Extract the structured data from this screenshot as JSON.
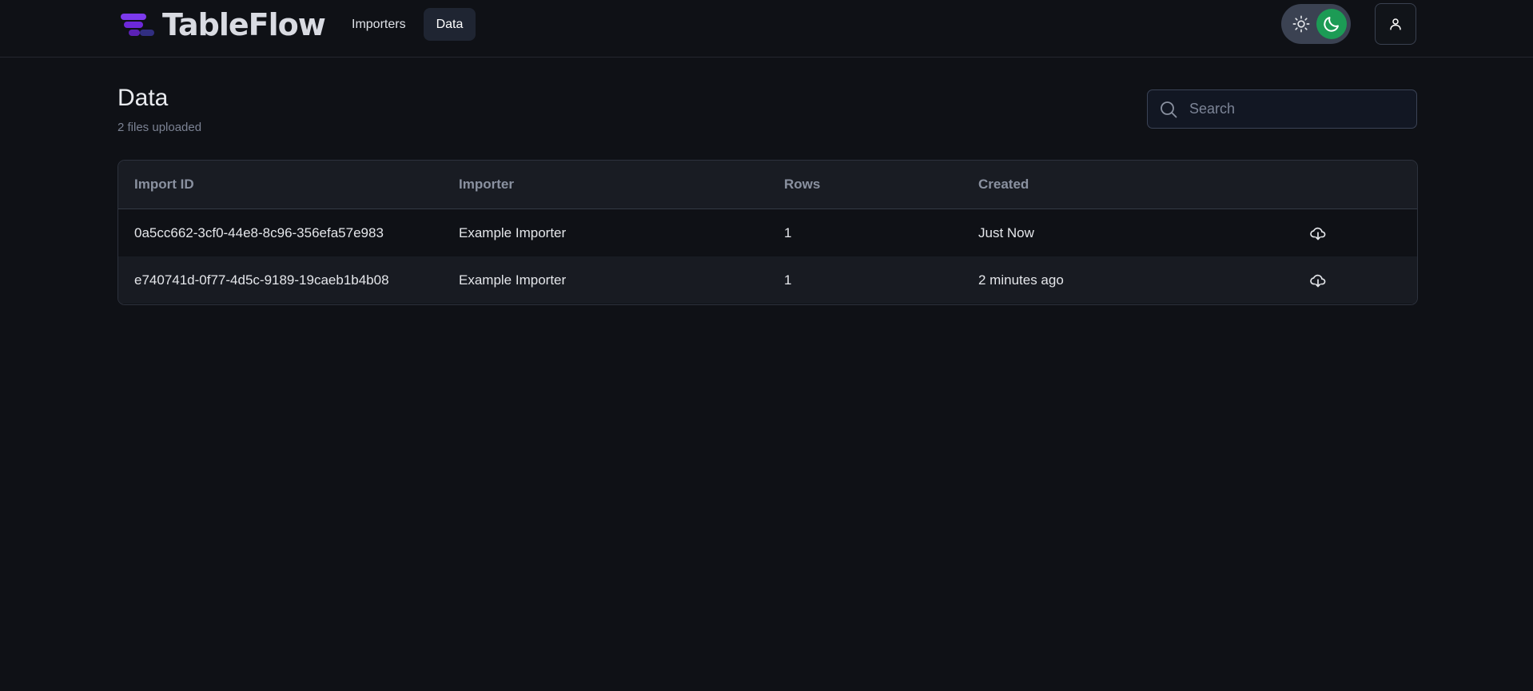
{
  "brand": {
    "name": "TableFlow",
    "colors": [
      "#7c3aed",
      "#5b21b6",
      "#4338ca",
      "#3730a3"
    ]
  },
  "nav": {
    "items": [
      {
        "label": "Importers",
        "active": false
      },
      {
        "label": "Data",
        "active": true
      }
    ]
  },
  "header_actions": {
    "theme_toggle": {
      "mode": "dark",
      "light_icon": "sun-icon",
      "dark_icon": "moon-icon",
      "accent": "#1c9b55"
    },
    "user_icon": "user-icon"
  },
  "page": {
    "title": "Data",
    "subtitle": "2 files uploaded"
  },
  "search": {
    "placeholder": "Search",
    "value": ""
  },
  "table": {
    "columns": [
      "Import ID",
      "Importer",
      "Rows",
      "Created",
      ""
    ],
    "rows": [
      {
        "import_id": "0a5cc662-3cf0-44e8-8c96-356efa57e983",
        "importer": "Example Importer",
        "rows": "1",
        "created": "Just Now",
        "action_icon": "cloud-download-icon"
      },
      {
        "import_id": "e740741d-0f77-4d5c-9189-19caeb1b4b08",
        "importer": "Example Importer",
        "rows": "1",
        "created": "2 minutes ago",
        "action_icon": "cloud-download-icon"
      }
    ]
  }
}
